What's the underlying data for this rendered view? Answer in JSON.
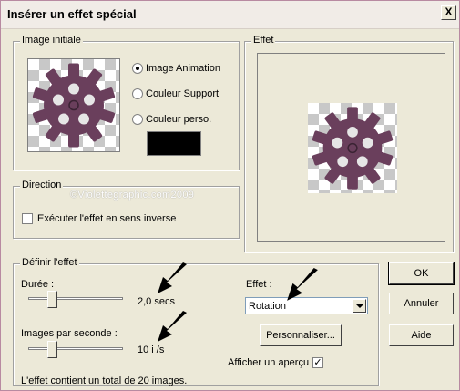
{
  "window": {
    "title": "Insérer un effet spécial",
    "close_label": "X"
  },
  "image_initiale": {
    "legend": "Image initiale",
    "options": [
      {
        "label": "Image Animation",
        "selected": true
      },
      {
        "label": "Couleur Support",
        "selected": false
      },
      {
        "label": "Couleur perso.",
        "selected": false
      }
    ],
    "custom_color": "#000000"
  },
  "effet_preview": {
    "legend": "Effet"
  },
  "direction": {
    "legend": "Direction",
    "reverse_label": "Exécuter l'effet en sens inverse",
    "reverse_checked": false
  },
  "watermark": "©Violettegraphic.com2009",
  "definir": {
    "legend": "Définir l'effet",
    "duree_label": "Durée :",
    "duree_value": "2,0 secs",
    "ips_label": "Images par seconde :",
    "ips_value": "10 i /s",
    "total_text": "L'effet contient un total de 20 images.",
    "effet_label": "Effet :",
    "effet_selected": "Rotation",
    "personnaliser_label": "Personnaliser...",
    "apercu_label": "Afficher un aperçu",
    "apercu_checked": true,
    "check_mark": "✓"
  },
  "buttons": {
    "ok": "OK",
    "annuler": "Annuler",
    "aide": "Aide"
  },
  "colors": {
    "gear": "#6a3f5c",
    "arrow": "#000000"
  }
}
